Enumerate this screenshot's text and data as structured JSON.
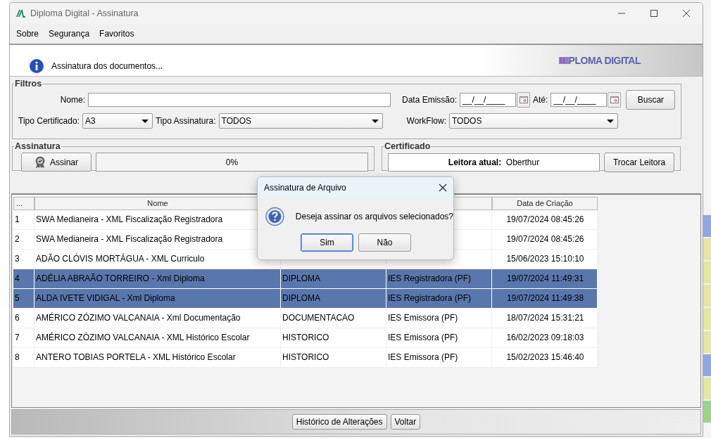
{
  "background_window": {
    "right_cells": [
      {
        "color": "#8fa8e0"
      },
      {
        "color": "#e6e6a0"
      },
      {
        "color": "#e6e6a0"
      },
      {
        "color": "#e6e6a0"
      },
      {
        "color": "#e6e6a0"
      },
      {
        "color": "#e6e6a0"
      },
      {
        "color": "#8fa8e0"
      },
      {
        "color": "#e6e6a0"
      },
      {
        "color": "#9ed38a"
      }
    ]
  },
  "window": {
    "title": "Diploma Digital - Assinatura"
  },
  "menu": [
    {
      "label": "Sobre"
    },
    {
      "label": "Segurança"
    },
    {
      "label": "Favoritos"
    }
  ],
  "banner": {
    "message": "Assinatura dos documentos...",
    "logo": "PLOMA DIGITAL"
  },
  "filters": {
    "title": "Filtros",
    "nome_label": "Nome:",
    "data_emissao_label": "Data Emissão:",
    "data_emissao_value": "__/__/____",
    "ate_label": "Até:",
    "ate_value": "__/__/____",
    "search_button": "Buscar",
    "tipo_certificado_label": "Tipo Certificado:",
    "tipo_certificado_value": "A3",
    "tipo_assinatura_label": "Tipo Assinatura:",
    "tipo_assinatura_value": "TODOS",
    "workflow_label": "WorkFlow:",
    "workflow_value": "TODOS"
  },
  "assinatura": {
    "title": "Assinatura",
    "button": "Assinar",
    "progress_text": "0%",
    "level": 0
  },
  "certificado": {
    "title": "Certificado",
    "reader_label": "Leitora atual:",
    "reader_value": "Oberthur",
    "button": "Trocar Leitora"
  },
  "table": {
    "columns": [
      "...",
      "Nome",
      "",
      "",
      "Data de Criação"
    ],
    "rows": [
      {
        "number": "1",
        "name": "SWA Medianeira - XML Fiscalização Registradora",
        "created": "19/07/2024 08:45:26",
        "selected": false
      },
      {
        "number": "2",
        "name": "SWA Medianeira - XML Fiscalização Registradora",
        "created": "19/07/2024 08:45:26",
        "selected": false
      },
      {
        "number": "3",
        "name": "ADÃO CLÓVIS MORTÁGUA - XML Curriculo",
        "created": "15/06/2023 15:10:10",
        "selected": false
      },
      {
        "number": "4",
        "name": "ADÉLIA ABRAÃO TORREIRO - Xml Diploma",
        "column_3": "DIPLOMA",
        "column_4": "IES Registradora (PF)",
        "created": "19/07/2024 11:49:31",
        "selected": true
      },
      {
        "number": "5",
        "name": "ALDA IVETE VIDIGAL - Xml Diploma",
        "column_3": "DIPLOMA",
        "column_4": "IES Registradora (PF)",
        "created": "19/07/2024 11:49:38",
        "selected": true
      },
      {
        "number": "6",
        "name": "AMÉRICO ZÓZIMO VALCANAIA - Xml Documentação",
        "column_3": "DOCUMENTACAO",
        "column_4": "IES Emissora (PF)",
        "created": "18/07/2024 15:31:21",
        "selected": false
      },
      {
        "number": "7",
        "name": "AMÉRICO ZÓZIMO VALCANAIA - XML Histórico Escolar",
        "column_3": "HISTORICO",
        "column_4": "IES Emissora (PF)",
        "created": "16/02/2023 09:18:03",
        "selected": false
      },
      {
        "number": "8",
        "name": "ANTERO TOBIAS PORTELA - XML Histórico Escolar",
        "column_3": "HISTORICO",
        "column_4": "IES Emissora (PF)",
        "created": "15/02/2023 15:46:40",
        "selected": false
      }
    ]
  },
  "footer_buttons": [
    {
      "label": "Histórico de Alterações"
    },
    {
      "label": "Voltar"
    }
  ],
  "dialog": {
    "title": "Assinatura de Arquivo",
    "message": "Deseja assinar os arquivos selecionados?",
    "buttons": [
      {
        "label": "Sim",
        "selected": true
      },
      {
        "label": "Não",
        "selected": false
      }
    ]
  }
}
